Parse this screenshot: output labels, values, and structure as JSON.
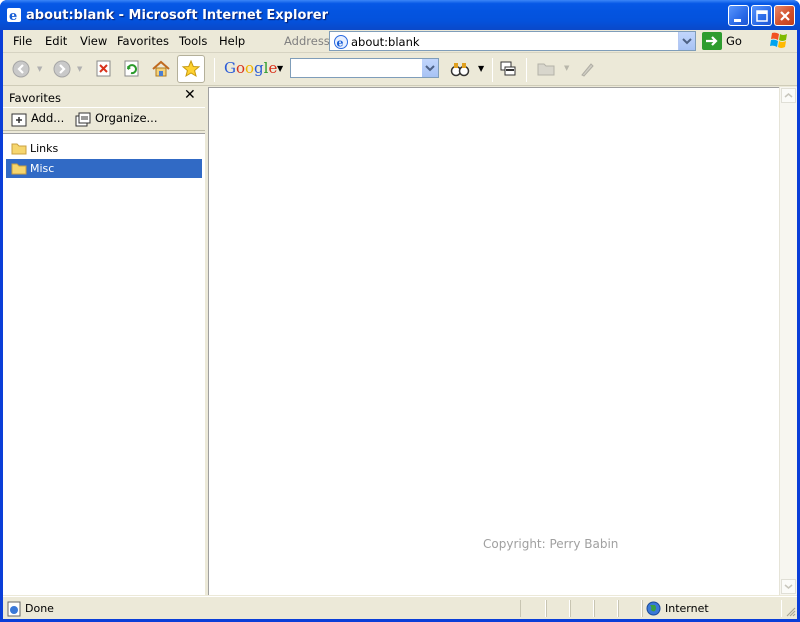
{
  "window": {
    "title": "about:blank - Microsoft Internet Explorer"
  },
  "menu": {
    "items": [
      "File",
      "Edit",
      "View",
      "Favorites",
      "Tools",
      "Help"
    ]
  },
  "address": {
    "label": "Address",
    "value": "about:blank",
    "go_label": "Go"
  },
  "toolbar": {
    "icons": [
      "back-icon",
      "forward-icon",
      "stop-icon",
      "refresh-icon",
      "home-icon",
      "favorites-star-icon"
    ],
    "google_label": "Google",
    "search_value": ""
  },
  "favorites": {
    "title": "Favorites",
    "add_label": "Add...",
    "organize_label": "Organize...",
    "items": [
      {
        "label": "Links",
        "selected": false
      },
      {
        "label": "Misc",
        "selected": true
      }
    ]
  },
  "content": {
    "watermark": "Copyright: Perry Babin"
  },
  "status": {
    "text": "Done",
    "zone": "Internet"
  },
  "colors": {
    "titlebar": "#0454e0",
    "selection": "#316ac5",
    "chrome": "#ece9d8"
  }
}
